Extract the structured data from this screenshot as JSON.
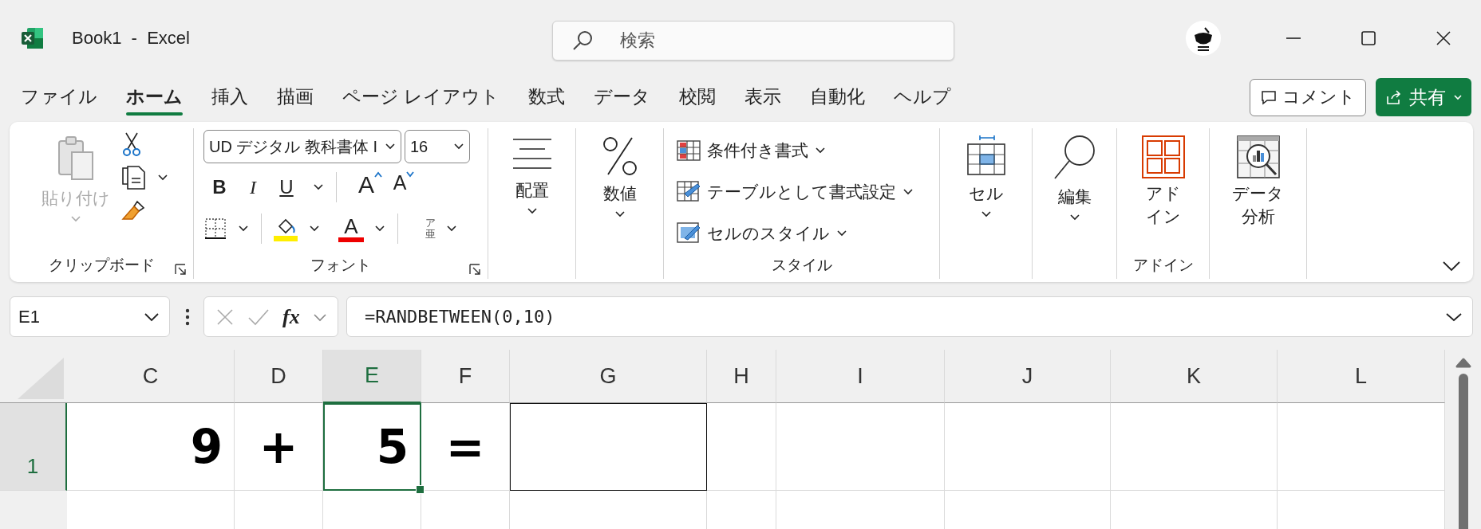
{
  "window": {
    "title": "Book1  -  Excel",
    "search": {
      "placeholder": "検索"
    }
  },
  "menu_tabs": [
    {
      "label": "ファイル",
      "selected": false
    },
    {
      "label": "ホーム",
      "selected": true
    },
    {
      "label": "挿入",
      "selected": false
    },
    {
      "label": "描画",
      "selected": false
    },
    {
      "label": "ページ レイアウト",
      "selected": false
    },
    {
      "label": "数式",
      "selected": false
    },
    {
      "label": "データ",
      "selected": false
    },
    {
      "label": "校閲",
      "selected": false
    },
    {
      "label": "表示",
      "selected": false
    },
    {
      "label": "自動化",
      "selected": false
    },
    {
      "label": "ヘルプ",
      "selected": false
    }
  ],
  "comment_button": "コメント",
  "share_button": "共有",
  "ribbon": {
    "clipboard": {
      "paste": {
        "label": "貼り付け",
        "disabled": true
      },
      "group_label": "クリップボード"
    },
    "font": {
      "font_name": "UD デジタル 教科書体 I",
      "font_size": "16",
      "bold": "B",
      "italic": "I",
      "underline": "U",
      "grow": "A",
      "shrink": "A",
      "font_color": "A",
      "phonetic": "ア亜",
      "group_label": "フォント"
    },
    "alignment": {
      "label": "配置"
    },
    "number": {
      "label": "数値"
    },
    "styles": {
      "items": [
        {
          "kind": "conditional",
          "label": "条件付き書式"
        },
        {
          "kind": "table",
          "label": "テーブルとして書式設定"
        },
        {
          "kind": "cellstyle",
          "label": "セルのスタイル"
        }
      ],
      "group_label": "スタイル"
    },
    "cells": {
      "label": "セル"
    },
    "editing": {
      "label": "編集"
    },
    "addins": {
      "label_lines": [
        "アド",
        "イン"
      ],
      "group_label": "アドイン"
    },
    "data_analysis": {
      "label_lines": [
        "データ",
        "分析"
      ]
    }
  },
  "formula_bar": {
    "name_box": "E1",
    "fx": "fx",
    "formula": "=RANDBETWEEN(0,10)"
  },
  "columns": [
    {
      "label": "C",
      "selected": false
    },
    {
      "label": "D",
      "selected": false
    },
    {
      "label": "E",
      "selected": true
    },
    {
      "label": "F",
      "selected": false
    },
    {
      "label": "G",
      "selected": false
    },
    {
      "label": "H",
      "selected": false
    },
    {
      "label": "I",
      "selected": false
    },
    {
      "label": "J",
      "selected": false
    },
    {
      "label": "K",
      "selected": false
    },
    {
      "label": "L",
      "selected": false
    }
  ],
  "rows": [
    {
      "label": "1",
      "selected": true,
      "cells": [
        {
          "value": "9",
          "kind": "number",
          "selected": false,
          "bordered": false
        },
        {
          "value": "+",
          "kind": "symbol",
          "selected": false,
          "bordered": false
        },
        {
          "value": "5",
          "kind": "number",
          "selected": true,
          "bordered": false
        },
        {
          "value": "=",
          "kind": "symbol",
          "selected": false,
          "bordered": false
        },
        {
          "selected": false,
          "bordered": true
        },
        {
          "selected": false,
          "bordered": false
        },
        {
          "selected": false,
          "bordered": false
        },
        {
          "selected": false,
          "bordered": false
        },
        {
          "selected": false,
          "bordered": false
        },
        {
          "selected": false,
          "bordered": false
        }
      ]
    }
  ]
}
